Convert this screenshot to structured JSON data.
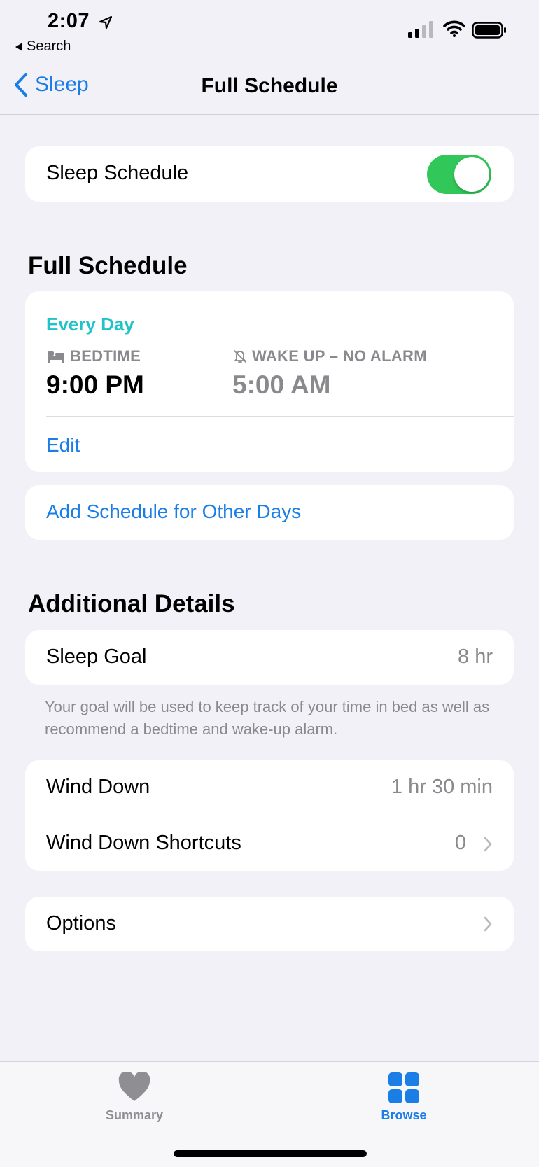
{
  "status": {
    "time": "2:07",
    "back_app": "Search"
  },
  "nav": {
    "back_label": "Sleep",
    "title": "Full Schedule"
  },
  "sleep_schedule": {
    "label": "Sleep Schedule",
    "enabled": true,
    "toggle_color": "#31c759"
  },
  "full_schedule": {
    "heading": "Full Schedule",
    "days": "Every Day",
    "bedtime_label": "BEDTIME",
    "bedtime_value": "9:00 PM",
    "wake_label": "WAKE UP – NO ALARM",
    "wake_value": "5:00 AM",
    "edit_label": "Edit",
    "add_schedule_label": "Add Schedule for Other Days"
  },
  "additional": {
    "heading": "Additional Details",
    "sleep_goal_label": "Sleep Goal",
    "sleep_goal_value": "8 hr",
    "footnote": "Your goal will be used to keep track of your time in bed as well as recommend a bedtime and wake-up alarm.",
    "wind_down_label": "Wind Down",
    "wind_down_value": "1 hr 30 min",
    "shortcuts_label": "Wind Down Shortcuts",
    "shortcuts_value": "0",
    "options_label": "Options"
  },
  "tabbar": {
    "summary_label": "Summary",
    "browse_label": "Browse",
    "active_color": "#1a7ee6",
    "inactive_color": "#8e8e93"
  },
  "icons": {
    "bed": "bed-icon",
    "alarm_off": "bell-slash-icon",
    "summary": "heart-icon",
    "browse": "grid-icon"
  }
}
